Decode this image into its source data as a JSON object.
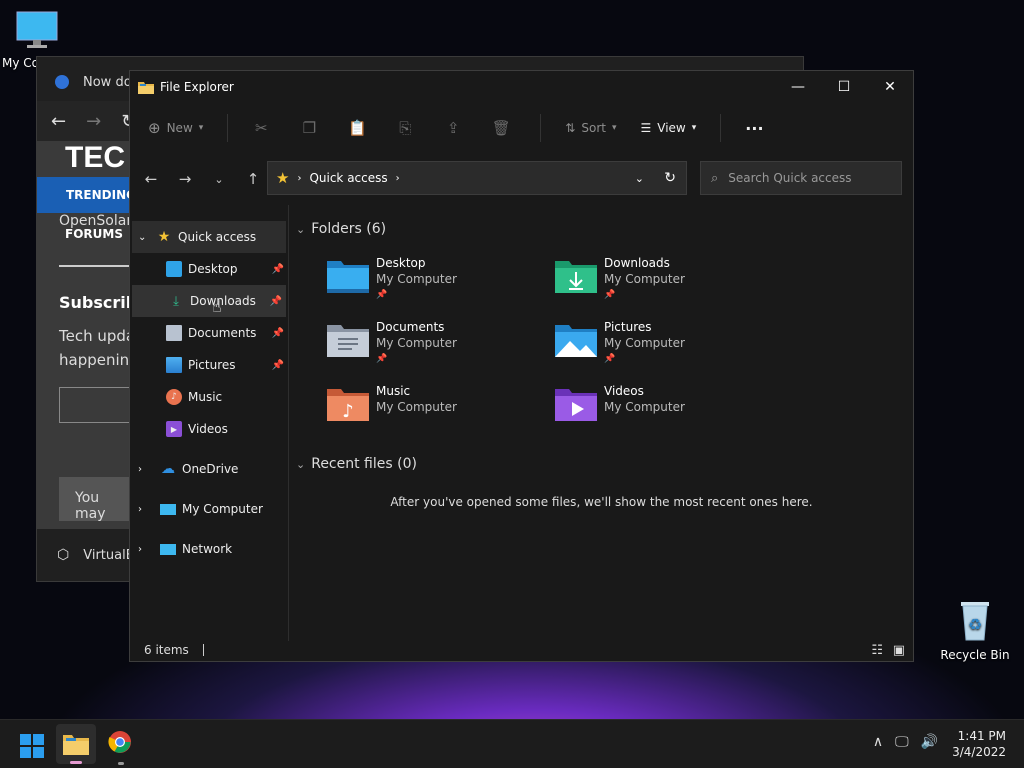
{
  "desktop": {
    "my_computer_label": "My Co",
    "recycle_bin_label": "Recycle Bin"
  },
  "browser": {
    "tab_title": "Now dow",
    "logo": "TEC",
    "trending": "TRENDING",
    "line1": "OpenSolar",
    "forums": "FORUMS",
    "subscribe": "Subscribe",
    "tech_line1": "Tech upda",
    "tech_line2": "happening",
    "you_may": "You may",
    "bottom_label": "VirtualB"
  },
  "explorer": {
    "title": "File Explorer",
    "toolbar": {
      "new_label": "New",
      "sort_label": "Sort",
      "view_label": "View",
      "more_label": "···"
    },
    "address": {
      "location": "Quick access"
    },
    "search": {
      "placeholder": "Search Quick access"
    },
    "sidebar": {
      "quick_access": "Quick access",
      "items": [
        {
          "label": "Desktop"
        },
        {
          "label": "Downloads"
        },
        {
          "label": "Documents"
        },
        {
          "label": "Pictures"
        },
        {
          "label": "Music"
        },
        {
          "label": "Videos"
        }
      ],
      "onedrive": "OneDrive",
      "my_computer": "My Computer",
      "network": "Network"
    },
    "folders_header": "Folders (6)",
    "folders": [
      {
        "name": "Desktop",
        "location": "My Computer"
      },
      {
        "name": "Downloads",
        "location": "My Computer"
      },
      {
        "name": "Documents",
        "location": "My Computer"
      },
      {
        "name": "Pictures",
        "location": "My Computer"
      },
      {
        "name": "Music",
        "location": "My Computer"
      },
      {
        "name": "Videos",
        "location": "My Computer"
      }
    ],
    "recent_header": "Recent files (0)",
    "recent_empty": "After you've opened some files, we'll show the most recent ones here.",
    "status_items": "6 items"
  },
  "taskbar": {
    "time": "1:41 PM",
    "date": "3/4/2022"
  },
  "colors": {
    "accent": "#0a84ff",
    "folder_blue": "#2fa3e8",
    "folder_yellow": "#e8b84a"
  }
}
